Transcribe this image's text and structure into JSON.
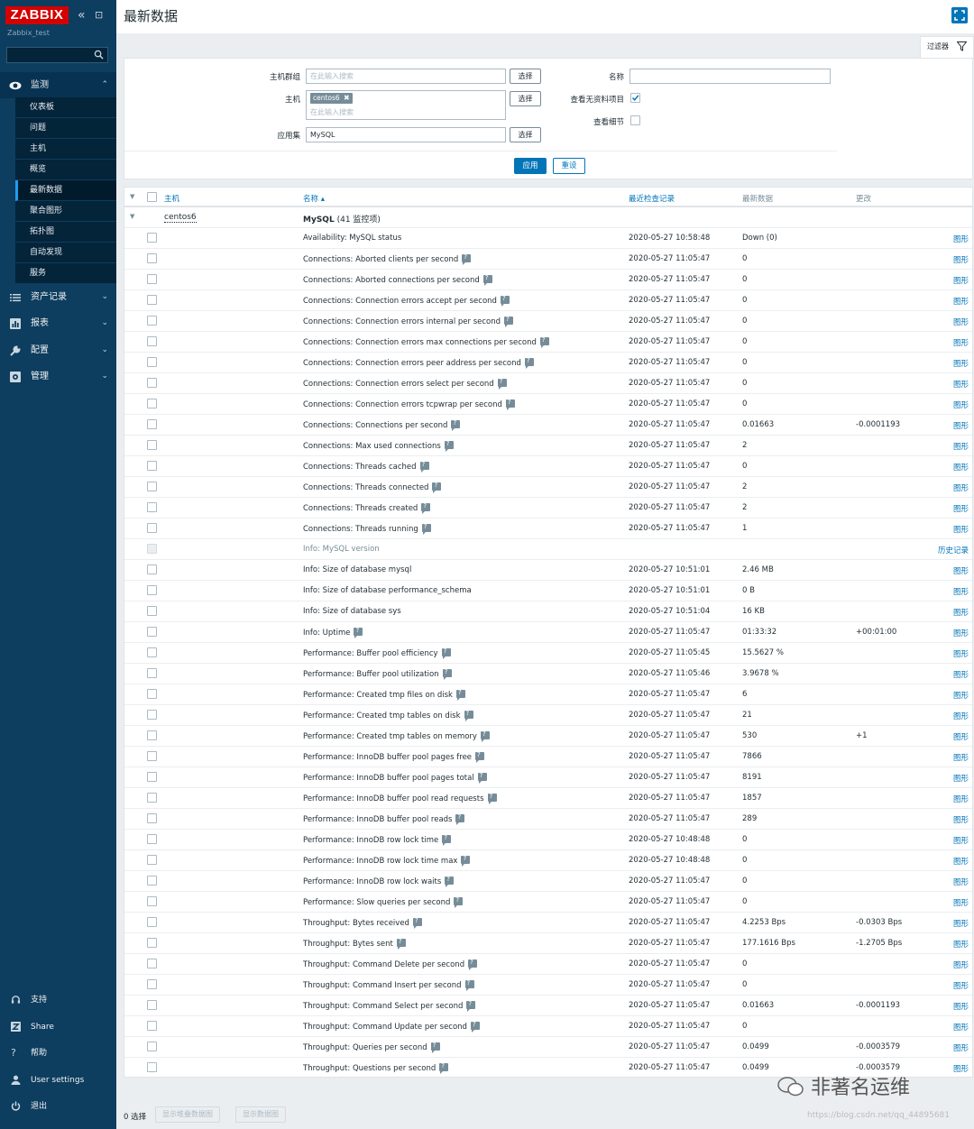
{
  "sidebar": {
    "logo": "ZABBIX",
    "server_name": "Zabbix_test",
    "menus": [
      {
        "label": "监测",
        "icon": "eye-icon"
      },
      {
        "label": "资产记录",
        "icon": "list-icon"
      },
      {
        "label": "报表",
        "icon": "bar-chart-icon"
      },
      {
        "label": "配置",
        "icon": "wrench-icon"
      },
      {
        "label": "管理",
        "icon": "gear-icon"
      }
    ],
    "submenu": [
      "仪表板",
      "问题",
      "主机",
      "概览",
      "最新数据",
      "聚合图形",
      "拓扑图",
      "自动发现",
      "服务"
    ],
    "bottom": [
      {
        "label": "支持",
        "icon": "headset-icon"
      },
      {
        "label": "Share",
        "icon": "share-z-icon"
      },
      {
        "label": "帮助",
        "icon": "help-icon"
      },
      {
        "label": "User settings",
        "icon": "user-icon"
      },
      {
        "label": "退出",
        "icon": "power-icon"
      }
    ]
  },
  "header": {
    "title": "最新数据",
    "filter_tab": "过滤器"
  },
  "filter": {
    "host_group_label": "主机群组",
    "host_group_placeholder": "在此输入搜索",
    "select": "选择",
    "host_label": "主机",
    "host_chip": "centos6",
    "host_placeholder": "在此输入搜索",
    "app_label": "应用集",
    "app_value": "MySQL",
    "name_label": "名称",
    "name_value": "",
    "show_no_data_label": "查看无资料项目",
    "show_no_data": true,
    "show_details_label": "查看细节",
    "show_details": false,
    "apply": "应用",
    "reset": "重设"
  },
  "table": {
    "headers": {
      "host": "主机",
      "name": "名称 ▴",
      "last_check": "最近检查记录",
      "last_value": "最新数据",
      "change": "更改"
    },
    "group": {
      "host": "centos6",
      "app": "MySQL",
      "count": "(41 监控项)"
    },
    "rows": [
      {
        "name": "Availability: MySQL status",
        "help": false,
        "check": "2020-05-27 10:58:48",
        "value": "Down (0)",
        "change": "",
        "link": "图形"
      },
      {
        "name": "Connections: Aborted clients per second",
        "help": true,
        "check": "2020-05-27 11:05:47",
        "value": "0",
        "change": "",
        "link": "图形"
      },
      {
        "name": "Connections: Aborted connections per second",
        "help": true,
        "check": "2020-05-27 11:05:47",
        "value": "0",
        "change": "",
        "link": "图形"
      },
      {
        "name": "Connections: Connection errors accept per second",
        "help": true,
        "check": "2020-05-27 11:05:47",
        "value": "0",
        "change": "",
        "link": "图形"
      },
      {
        "name": "Connections: Connection errors internal per second",
        "help": true,
        "check": "2020-05-27 11:05:47",
        "value": "0",
        "change": "",
        "link": "图形"
      },
      {
        "name": "Connections: Connection errors max connections per second",
        "help": true,
        "check": "2020-05-27 11:05:47",
        "value": "0",
        "change": "",
        "link": "图形"
      },
      {
        "name": "Connections: Connection errors peer address per second",
        "help": true,
        "check": "2020-05-27 11:05:47",
        "value": "0",
        "change": "",
        "link": "图形"
      },
      {
        "name": "Connections: Connection errors select per second",
        "help": true,
        "check": "2020-05-27 11:05:47",
        "value": "0",
        "change": "",
        "link": "图形"
      },
      {
        "name": "Connections: Connection errors tcpwrap per second",
        "help": true,
        "check": "2020-05-27 11:05:47",
        "value": "0",
        "change": "",
        "link": "图形"
      },
      {
        "name": "Connections: Connections per second",
        "help": true,
        "check": "2020-05-27 11:05:47",
        "value": "0.01663",
        "change": "-0.0001193",
        "link": "图形"
      },
      {
        "name": "Connections: Max used connections",
        "help": true,
        "check": "2020-05-27 11:05:47",
        "value": "2",
        "change": "",
        "link": "图形"
      },
      {
        "name": "Connections: Threads cached",
        "help": true,
        "check": "2020-05-27 11:05:47",
        "value": "0",
        "change": "",
        "link": "图形"
      },
      {
        "name": "Connections: Threads connected",
        "help": true,
        "check": "2020-05-27 11:05:47",
        "value": "2",
        "change": "",
        "link": "图形"
      },
      {
        "name": "Connections: Threads created",
        "help": true,
        "check": "2020-05-27 11:05:47",
        "value": "2",
        "change": "",
        "link": "图形"
      },
      {
        "name": "Connections: Threads running",
        "help": true,
        "check": "2020-05-27 11:05:47",
        "value": "1",
        "change": "",
        "link": "图形"
      },
      {
        "name": "Info: MySQL version",
        "help": false,
        "check": "",
        "value": "",
        "change": "",
        "link": "历史记录",
        "disabled": true
      },
      {
        "name": "Info: Size of database mysql",
        "help": false,
        "check": "2020-05-27 10:51:01",
        "value": "2.46 MB",
        "change": "",
        "link": "图形"
      },
      {
        "name": "Info: Size of database performance_schema",
        "help": false,
        "check": "2020-05-27 10:51:01",
        "value": "0 B",
        "change": "",
        "link": "图形"
      },
      {
        "name": "Info: Size of database sys",
        "help": false,
        "check": "2020-05-27 10:51:04",
        "value": "16 KB",
        "change": "",
        "link": "图形"
      },
      {
        "name": "Info: Uptime",
        "help": true,
        "check": "2020-05-27 11:05:47",
        "value": "01:33:32",
        "change": "+00:01:00",
        "link": "图形"
      },
      {
        "name": "Performance: Buffer pool efficiency",
        "help": true,
        "check": "2020-05-27 11:05:45",
        "value": "15.5627 %",
        "change": "",
        "link": "图形"
      },
      {
        "name": "Performance: Buffer pool utilization",
        "help": true,
        "check": "2020-05-27 11:05:46",
        "value": "3.9678 %",
        "change": "",
        "link": "图形"
      },
      {
        "name": "Performance: Created tmp files on disk",
        "help": true,
        "check": "2020-05-27 11:05:47",
        "value": "6",
        "change": "",
        "link": "图形"
      },
      {
        "name": "Performance: Created tmp tables on disk",
        "help": true,
        "check": "2020-05-27 11:05:47",
        "value": "21",
        "change": "",
        "link": "图形"
      },
      {
        "name": "Performance: Created tmp tables on memory",
        "help": true,
        "check": "2020-05-27 11:05:47",
        "value": "530",
        "change": "+1",
        "link": "图形"
      },
      {
        "name": "Performance: InnoDB buffer pool pages free",
        "help": true,
        "check": "2020-05-27 11:05:47",
        "value": "7866",
        "change": "",
        "link": "图形"
      },
      {
        "name": "Performance: InnoDB buffer pool pages total",
        "help": true,
        "check": "2020-05-27 11:05:47",
        "value": "8191",
        "change": "",
        "link": "图形"
      },
      {
        "name": "Performance: InnoDB buffer pool read requests",
        "help": true,
        "check": "2020-05-27 11:05:47",
        "value": "1857",
        "change": "",
        "link": "图形"
      },
      {
        "name": "Performance: InnoDB buffer pool reads",
        "help": true,
        "check": "2020-05-27 11:05:47",
        "value": "289",
        "change": "",
        "link": "图形"
      },
      {
        "name": "Performance: InnoDB row lock time",
        "help": true,
        "check": "2020-05-27 10:48:48",
        "value": "0",
        "change": "",
        "link": "图形"
      },
      {
        "name": "Performance: InnoDB row lock time max",
        "help": true,
        "check": "2020-05-27 10:48:48",
        "value": "0",
        "change": "",
        "link": "图形"
      },
      {
        "name": "Performance: InnoDB row lock waits",
        "help": true,
        "check": "2020-05-27 11:05:47",
        "value": "0",
        "change": "",
        "link": "图形"
      },
      {
        "name": "Performance: Slow queries per second",
        "help": true,
        "check": "2020-05-27 11:05:47",
        "value": "0",
        "change": "",
        "link": "图形"
      },
      {
        "name": "Throughput: Bytes received",
        "help": true,
        "check": "2020-05-27 11:05:47",
        "value": "4.2253 Bps",
        "change": "-0.0303 Bps",
        "link": "图形"
      },
      {
        "name": "Throughput: Bytes sent",
        "help": true,
        "check": "2020-05-27 11:05:47",
        "value": "177.1616 Bps",
        "change": "-1.2705 Bps",
        "link": "图形"
      },
      {
        "name": "Throughput: Command Delete per second",
        "help": true,
        "check": "2020-05-27 11:05:47",
        "value": "0",
        "change": "",
        "link": "图形"
      },
      {
        "name": "Throughput: Command Insert per second",
        "help": true,
        "check": "2020-05-27 11:05:47",
        "value": "0",
        "change": "",
        "link": "图形"
      },
      {
        "name": "Throughput: Command Select per second",
        "help": true,
        "check": "2020-05-27 11:05:47",
        "value": "0.01663",
        "change": "-0.0001193",
        "link": "图形"
      },
      {
        "name": "Throughput: Command Update per second",
        "help": true,
        "check": "2020-05-27 11:05:47",
        "value": "0",
        "change": "",
        "link": "图形"
      },
      {
        "name": "Throughput: Queries per second",
        "help": true,
        "check": "2020-05-27 11:05:47",
        "value": "0.0499",
        "change": "-0.0003579",
        "link": "图形"
      },
      {
        "name": "Throughput: Questions per second",
        "help": true,
        "check": "2020-05-27 11:05:47",
        "value": "0.0499",
        "change": "-0.0003579",
        "link": "图形"
      }
    ]
  },
  "footer": {
    "selected": "0 选择",
    "btn_stacked": "显示堆叠数据图",
    "btn_graph": "显示数据图"
  },
  "watermark": {
    "main": "非著名运维",
    "url": "https://blog.csdn.net/qq_44895681"
  },
  "colors": {
    "sidebar_bg": "#0d3d5f",
    "accent": "#0275b8",
    "logo_red": "#d40000"
  }
}
